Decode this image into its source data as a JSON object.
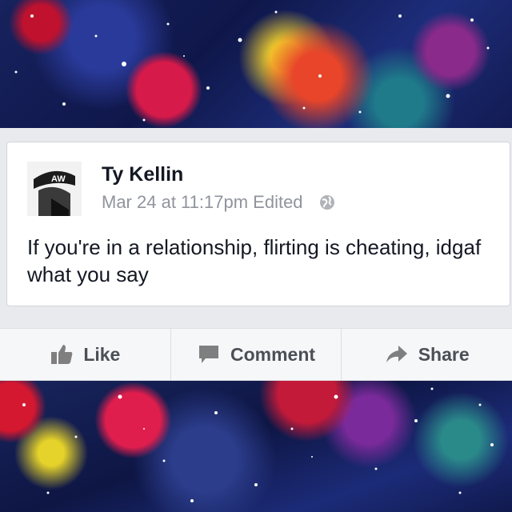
{
  "post": {
    "author": "Ty Kellin",
    "timestamp": "Mar 24 at 11:17pm",
    "edited": "Edited",
    "privacy_icon": "globe-icon",
    "avatar_text": "AW",
    "text": "If you're in a relationship, flirting is cheating, idgaf what you say"
  },
  "actions": {
    "like": "Like",
    "comment": "Comment",
    "share": "Share"
  },
  "colors": {
    "card_bg": "#ffffff",
    "name": "#141823",
    "meta": "#90949c",
    "action_text": "#4b4f56",
    "action_bg": "#f6f7f9"
  }
}
